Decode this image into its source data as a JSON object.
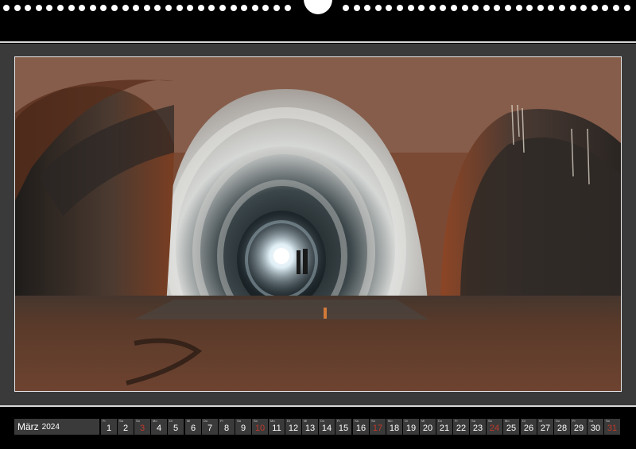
{
  "calendar": {
    "month": "März",
    "year": "2024",
    "days": [
      {
        "wd": "Fr",
        "n": "1",
        "sun": false
      },
      {
        "wd": "Sa",
        "n": "2",
        "sun": false
      },
      {
        "wd": "So",
        "n": "3",
        "sun": true
      },
      {
        "wd": "Mo",
        "n": "4",
        "sun": false
      },
      {
        "wd": "Di",
        "n": "5",
        "sun": false
      },
      {
        "wd": "Mi",
        "n": "6",
        "sun": false
      },
      {
        "wd": "Do",
        "n": "7",
        "sun": false
      },
      {
        "wd": "Fr",
        "n": "8",
        "sun": false
      },
      {
        "wd": "Sa",
        "n": "9",
        "sun": false
      },
      {
        "wd": "So",
        "n": "10",
        "sun": true
      },
      {
        "wd": "Mo",
        "n": "11",
        "sun": false
      },
      {
        "wd": "Di",
        "n": "12",
        "sun": false
      },
      {
        "wd": "Mi",
        "n": "13",
        "sun": false
      },
      {
        "wd": "Do",
        "n": "14",
        "sun": false
      },
      {
        "wd": "Fr",
        "n": "15",
        "sun": false
      },
      {
        "wd": "Sa",
        "n": "16",
        "sun": false
      },
      {
        "wd": "So",
        "n": "17",
        "sun": true
      },
      {
        "wd": "Mo",
        "n": "18",
        "sun": false
      },
      {
        "wd": "Di",
        "n": "19",
        "sun": false
      },
      {
        "wd": "Mi",
        "n": "20",
        "sun": false
      },
      {
        "wd": "Do",
        "n": "21",
        "sun": false
      },
      {
        "wd": "Fr",
        "n": "22",
        "sun": false
      },
      {
        "wd": "Sa",
        "n": "23",
        "sun": false
      },
      {
        "wd": "So",
        "n": "24",
        "sun": true
      },
      {
        "wd": "Mo",
        "n": "25",
        "sun": false
      },
      {
        "wd": "Di",
        "n": "26",
        "sun": false
      },
      {
        "wd": "Mi",
        "n": "27",
        "sun": false
      },
      {
        "wd": "Do",
        "n": "28",
        "sun": false
      },
      {
        "wd": "Fr",
        "n": "29",
        "sun": false
      },
      {
        "wd": "Sa",
        "n": "30",
        "sun": false
      },
      {
        "wd": "So",
        "n": "31",
        "sun": true
      }
    ]
  },
  "colors": {
    "sunday": "#c0392b",
    "panel": "#3a3a3a"
  }
}
